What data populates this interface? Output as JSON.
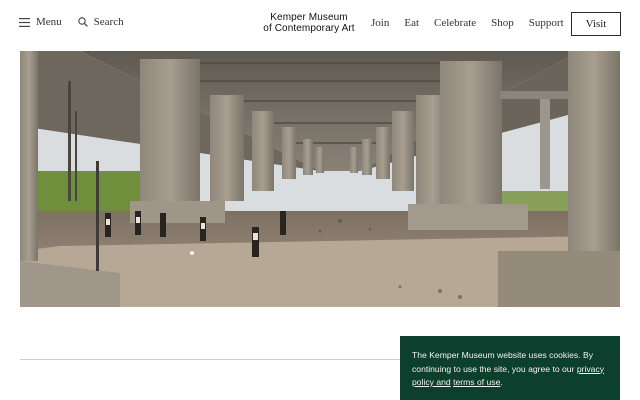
{
  "header": {
    "menu_label": "Menu",
    "search_label": "Search",
    "logo_line1": "Kemper Museum",
    "logo_line2": "of Contemporary Art",
    "nav": [
      "Join",
      "Eat",
      "Celebrate",
      "Shop",
      "Support"
    ],
    "visit_label": "Visit"
  },
  "hero": {
    "description_icon": "photo-under-highway-overpass"
  },
  "cookie": {
    "text_before": "The Kemper Museum website uses cookies. By continuing to use the site, you agree to our ",
    "link1": "privacy policy and",
    "link2": "terms of use",
    "text_after": ".",
    "bg_color": "#0d3f2e"
  }
}
